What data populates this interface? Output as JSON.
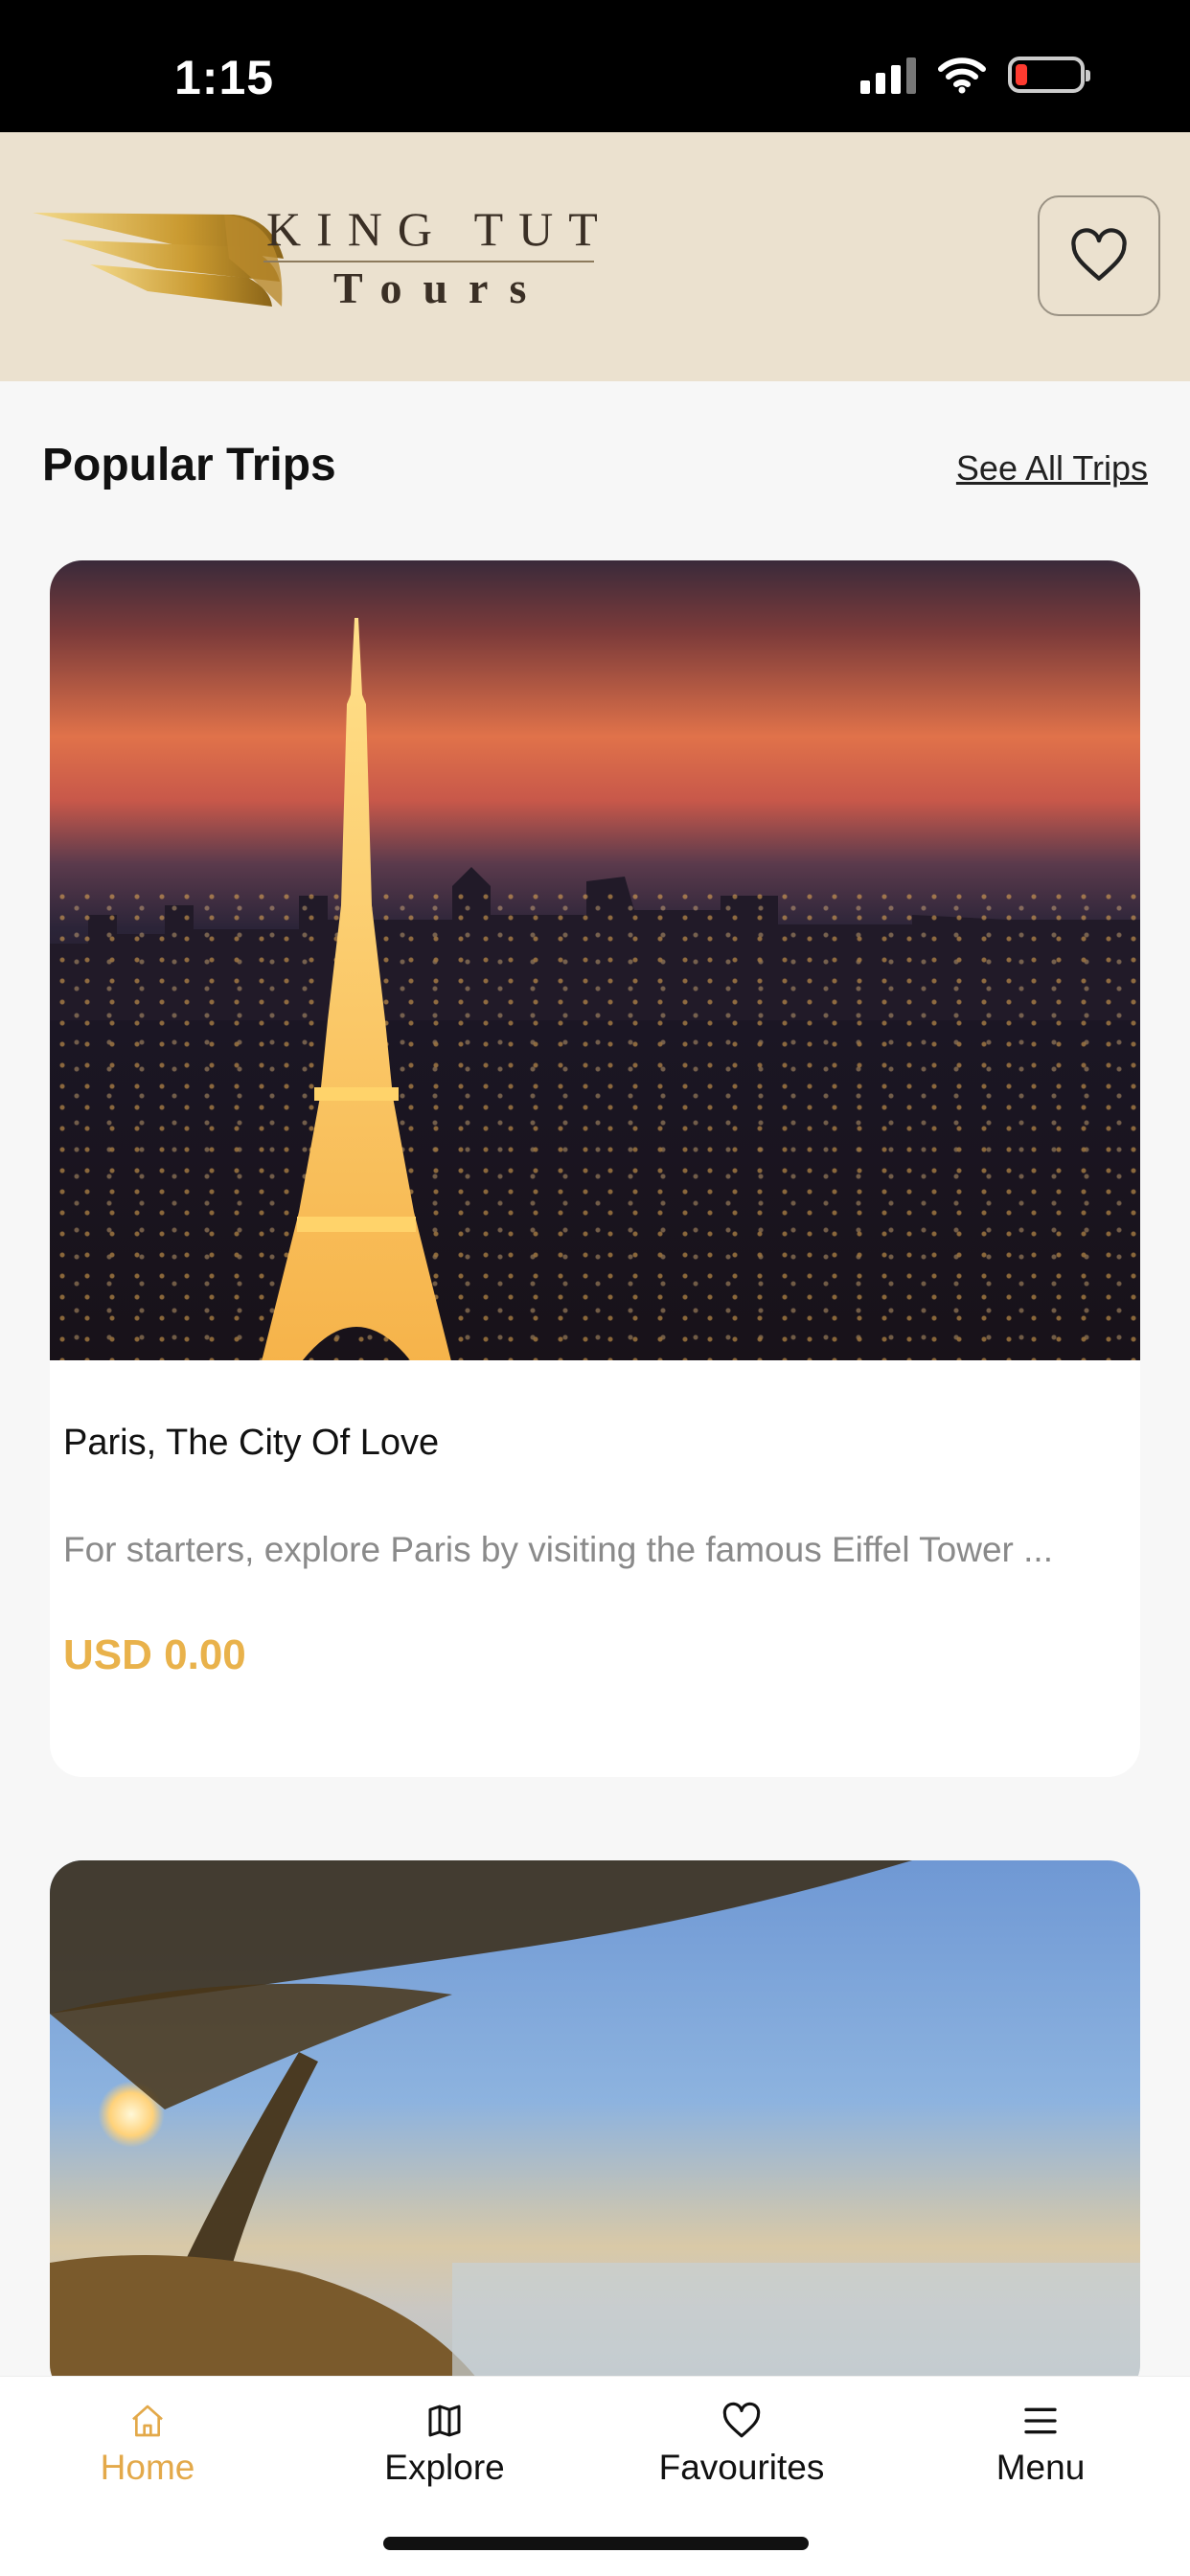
{
  "status_bar": {
    "time": "1:15"
  },
  "header": {
    "logo_line1": "KING TUT",
    "logo_line2": "Tours"
  },
  "section": {
    "title": "Popular Trips",
    "see_all": "See All Trips"
  },
  "trips": [
    {
      "title": "Paris, The City Of Love",
      "description": "For starters, explore Paris by visiting the famous Eiffel Tower ...",
      "price": "USD 0.00"
    }
  ],
  "nav": {
    "items": [
      {
        "label": "Home",
        "icon": "home-icon",
        "active": true
      },
      {
        "label": "Explore",
        "icon": "map-icon",
        "active": false
      },
      {
        "label": "Favourites",
        "icon": "heart-icon",
        "active": false
      },
      {
        "label": "Menu",
        "icon": "menu-icon",
        "active": false
      }
    ]
  },
  "colors": {
    "accent": "#e9b24b",
    "header_bg": "#ebe1cf",
    "background": "#f7f7f7"
  }
}
